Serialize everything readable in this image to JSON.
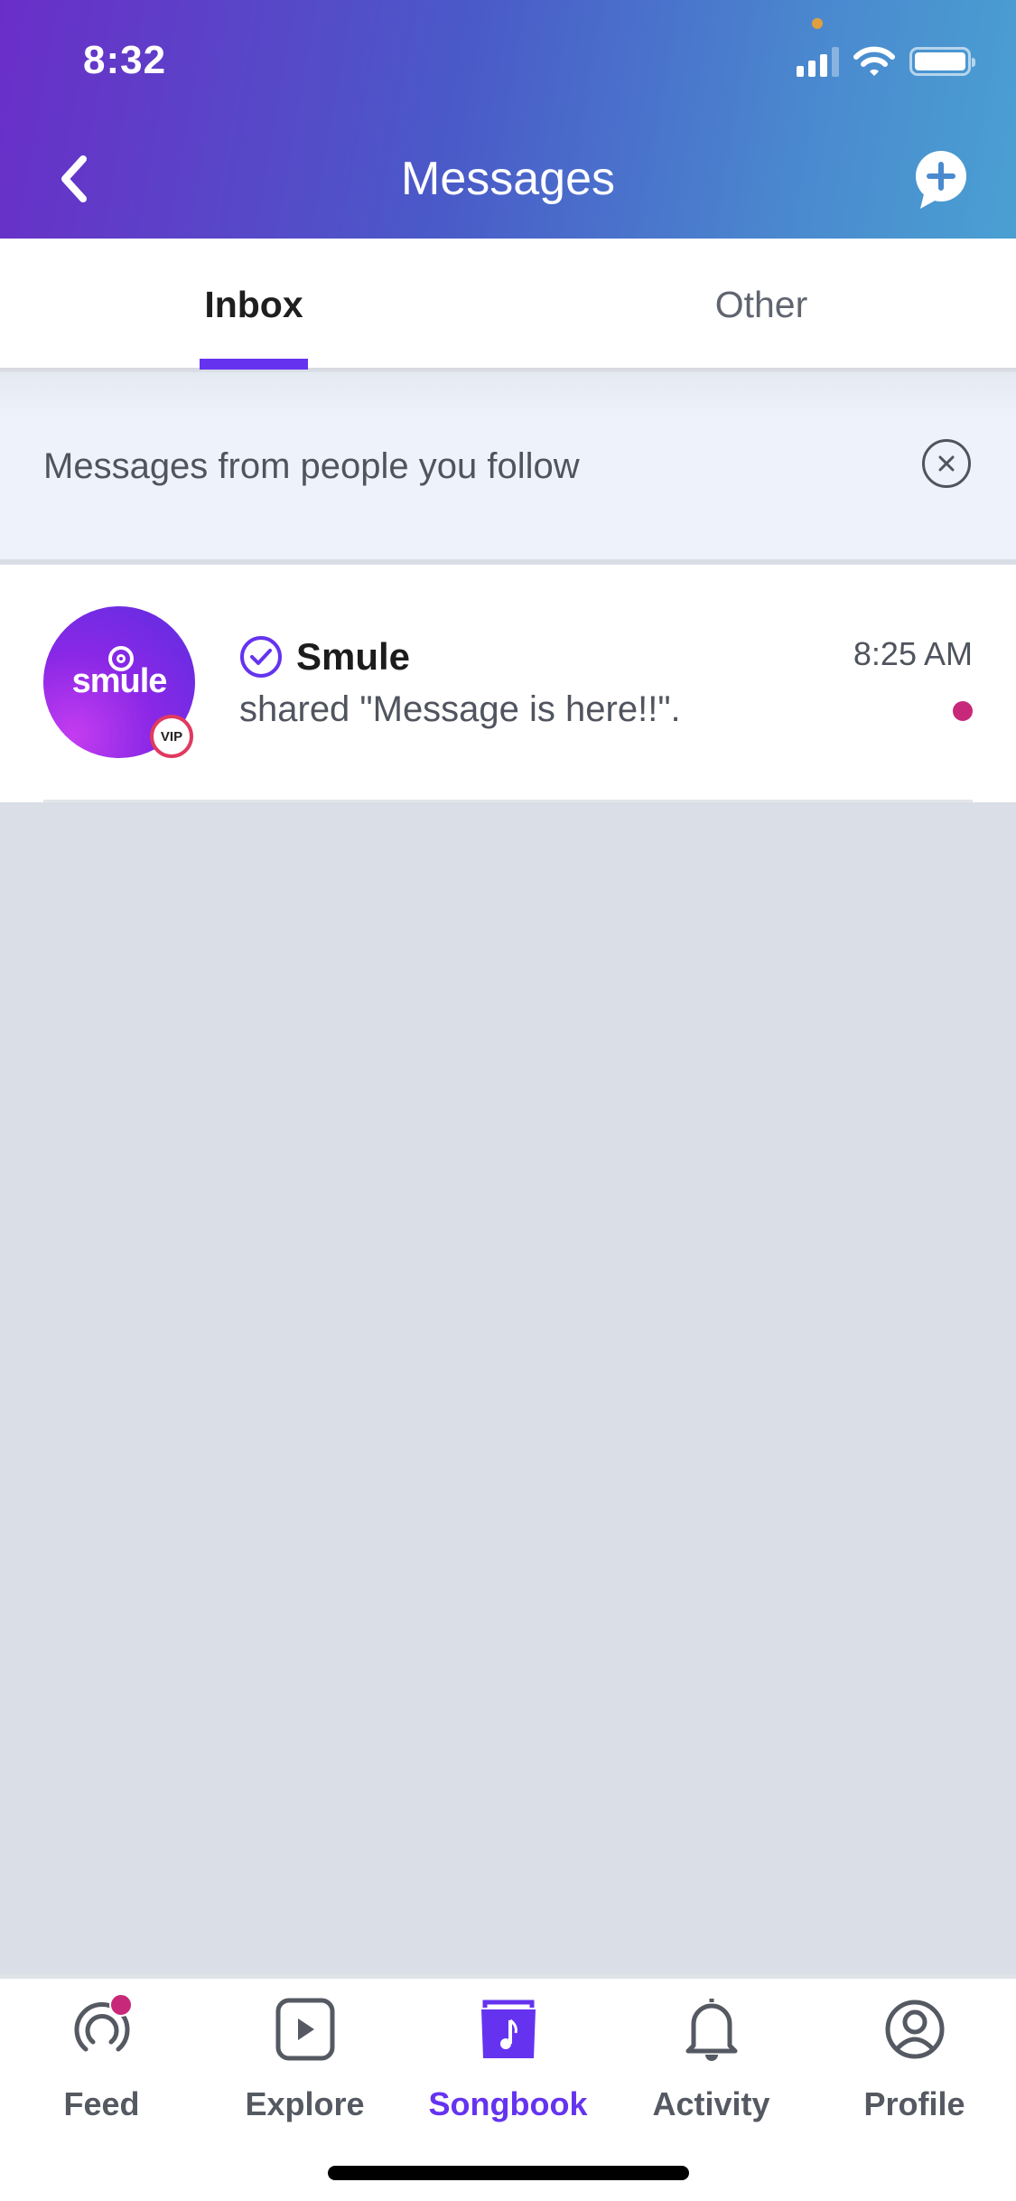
{
  "status_bar": {
    "time": "8:32"
  },
  "header": {
    "title": "Messages",
    "back_icon": "chevron-left-icon",
    "compose_icon": "compose-message-plus-icon"
  },
  "tabs": [
    {
      "label": "Inbox",
      "active": true
    },
    {
      "label": "Other",
      "active": false
    }
  ],
  "banner": {
    "text": "Messages from people you follow",
    "close_icon": "close-circle-icon"
  },
  "messages": [
    {
      "sender": "Smule",
      "verified": true,
      "badge": "VIP",
      "avatar_text": "smule",
      "preview": "shared \"Message is here!!\".",
      "time": "8:25 AM",
      "unread": true
    }
  ],
  "bottom_nav": [
    {
      "label": "Feed",
      "icon": "feed-icon",
      "notification": true,
      "active": false
    },
    {
      "label": "Explore",
      "icon": "play-square-icon",
      "active": false
    },
    {
      "label": "Songbook",
      "icon": "songbook-icon",
      "active": true
    },
    {
      "label": "Activity",
      "icon": "bell-icon",
      "active": false
    },
    {
      "label": "Profile",
      "icon": "profile-icon",
      "active": false
    }
  ],
  "colors": {
    "accent": "#6533f0",
    "unread": "#c8287a",
    "vip_ring": "#e03a60"
  }
}
